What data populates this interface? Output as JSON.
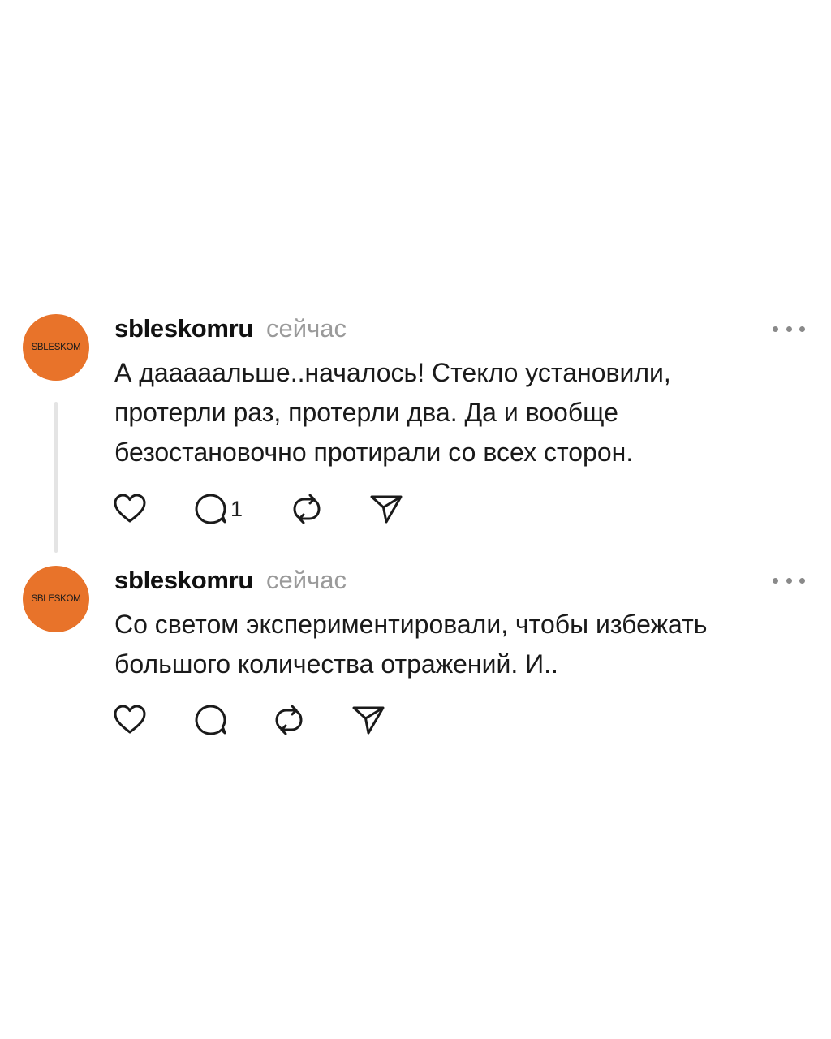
{
  "posts": [
    {
      "avatar_text": "SBLESKOM",
      "username": "sbleskomru",
      "time": "сейчас",
      "text": "А даааааль­ше..началось! Стекло установили,\nпротерли раз, протерли два. Да и вообще\nбезостановочно протирали со всех сторон.",
      "reply_count": "1",
      "icons": [
        "heart-icon",
        "comment-icon",
        "repost-icon",
        "share-icon"
      ]
    },
    {
      "avatar_text": "SBLESKOM",
      "username": "sbleskomru",
      "time": "сейчас",
      "text": "Со светом экспериментировали, чтобы избежать\nбольшого количества отражений. И..",
      "icons": [
        "heart-icon",
        "comment-icon",
        "repost-icon",
        "share-icon"
      ]
    }
  ],
  "colors": {
    "avatar_bg": "#E8732A",
    "timestamp": "#9a9a9a",
    "thread_line": "#e4e4e4"
  }
}
